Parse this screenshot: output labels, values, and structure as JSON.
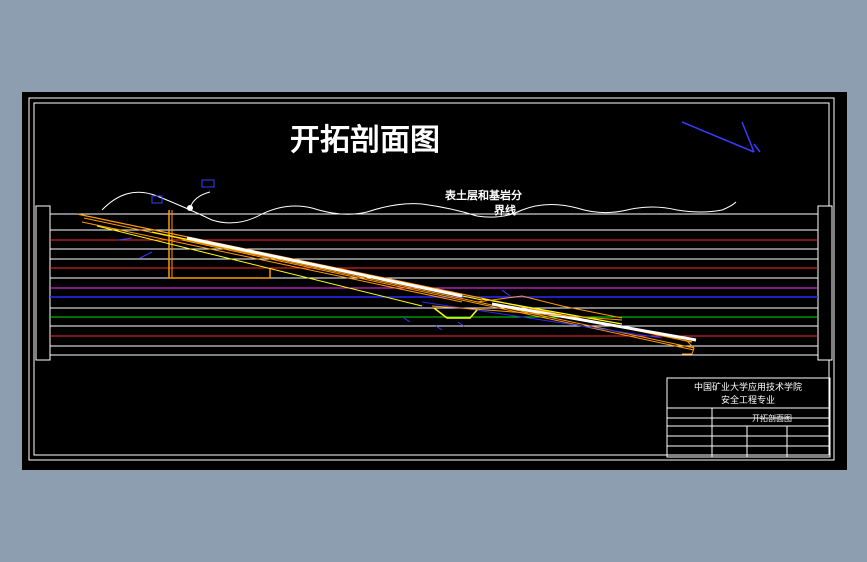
{
  "drawing": {
    "title": "开拓剖面图",
    "annotation_line1": "表土层和基岩分",
    "annotation_line2": "界线"
  },
  "title_block": {
    "institution": "中国矿业大学应用技术学院",
    "specialty": "安全工程专业",
    "drawing_name": "开拓剖面图"
  },
  "colors": {
    "background": "#000000",
    "frame": "#ffffff",
    "seam_orange": "#ff9900",
    "seam_yellow": "#ffff00",
    "seam_white": "#ffffff",
    "level_red": "#ff2a2a",
    "level_magenta": "#ff33ff",
    "level_blue": "#2a2aff",
    "level_green": "#00e000",
    "annotation_blue": "#3a3aff"
  }
}
